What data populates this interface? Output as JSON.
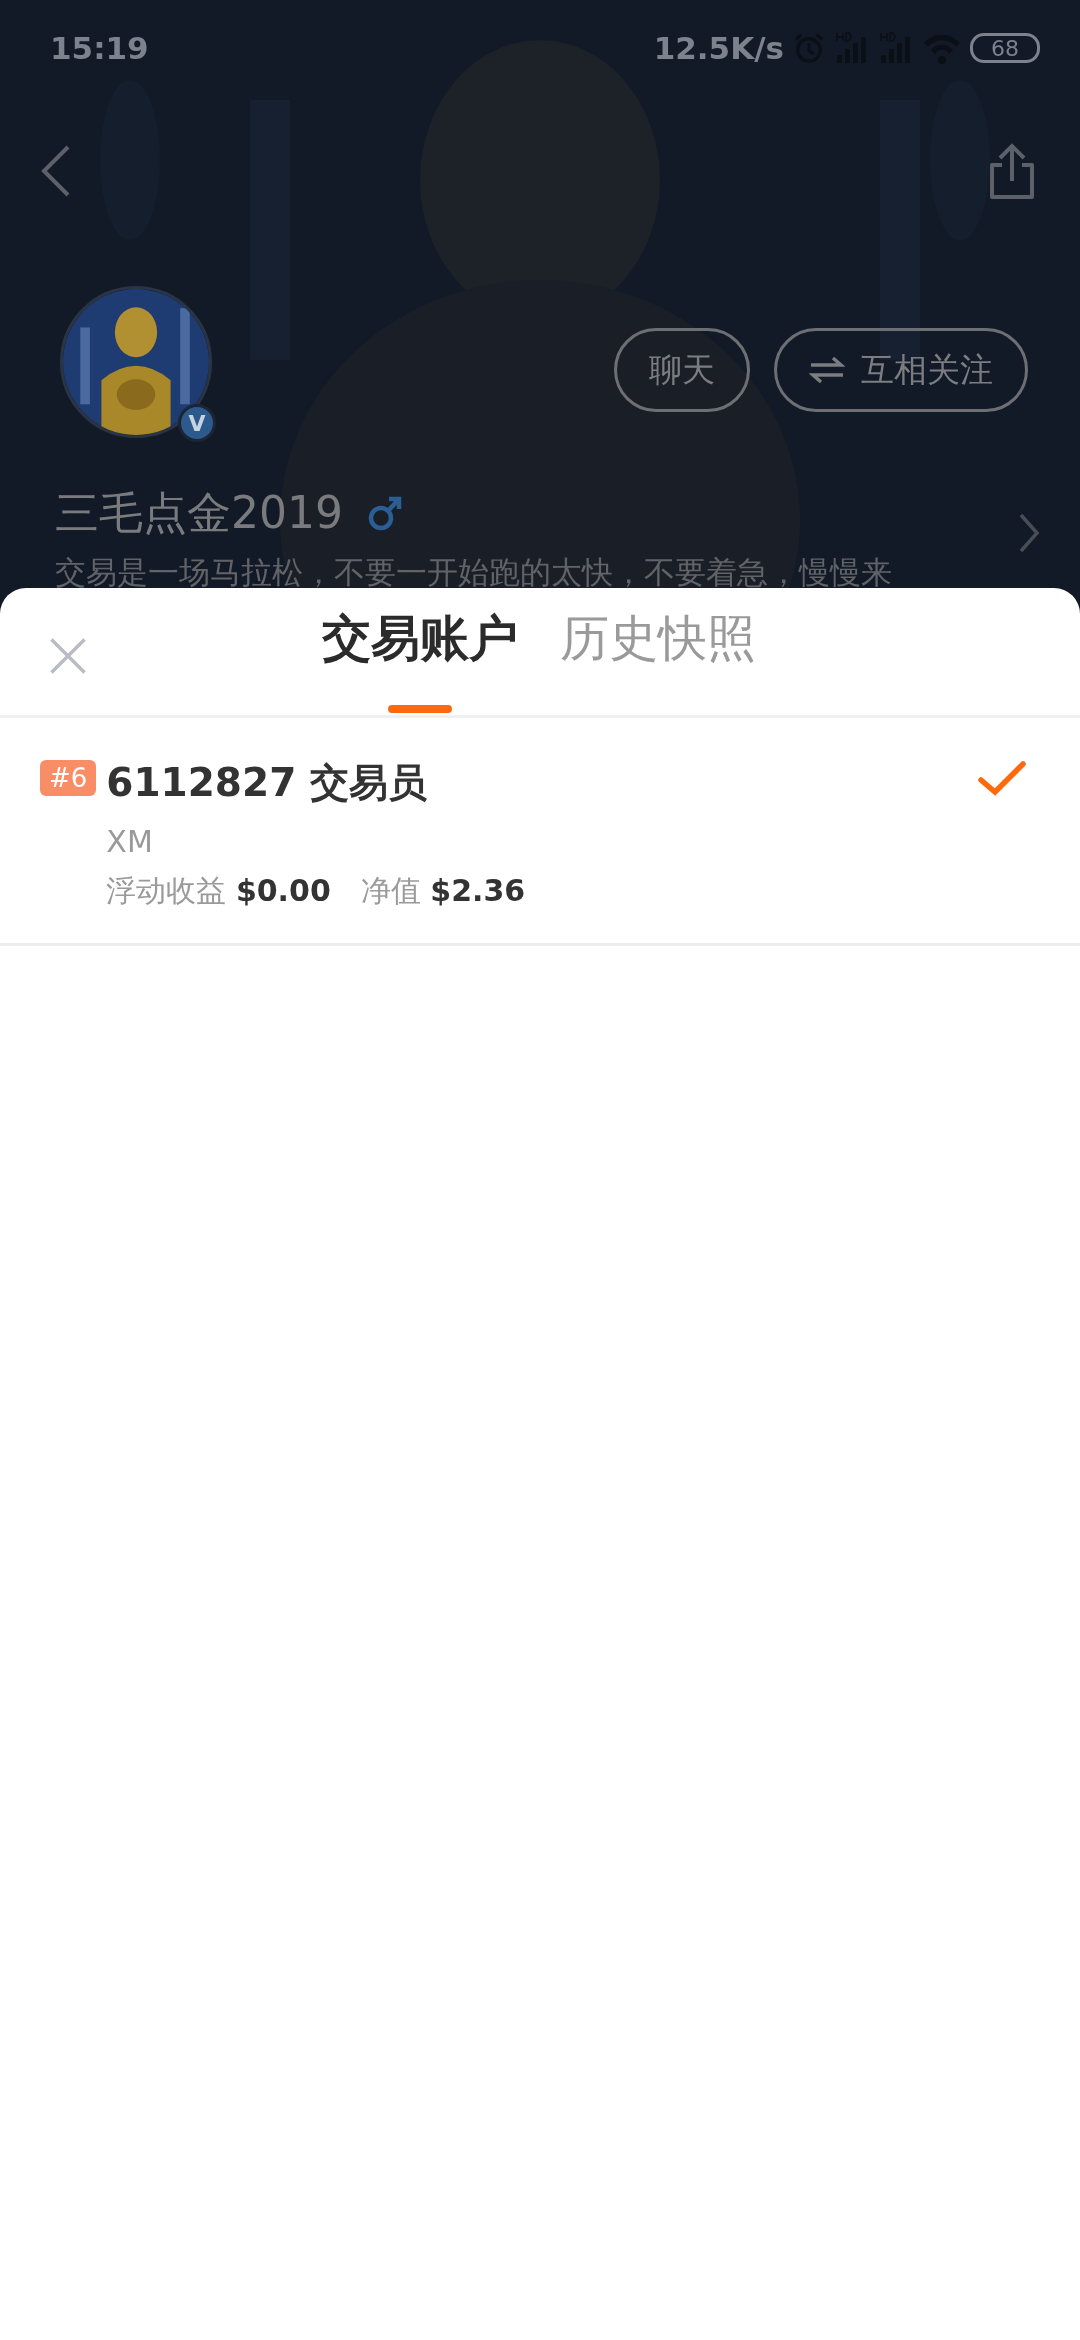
{
  "status_bar": {
    "time": "15:19",
    "network_speed": "12.5K/s",
    "battery": "68"
  },
  "profile": {
    "name": "三毛点金2019",
    "verified_badge": "V",
    "bio": "交易是一场马拉松，不要一开始跑的太快，不要着急，慢慢来",
    "buttons": [
      {
        "label": "聊天",
        "kind": "plain"
      },
      {
        "label": "互相关注",
        "kind": "mutual"
      }
    ]
  },
  "sheet": {
    "tabs": [
      {
        "label": "交易账户",
        "selected": true
      },
      {
        "label": "历史快照",
        "selected": false
      }
    ],
    "accounts": [
      {
        "rank": "#6",
        "title": "6112827 交易员",
        "broker": "XM",
        "floating_label": "浮动收益",
        "floating_value": "$0.00",
        "equity_label": "净值",
        "equity_value": "$2.36",
        "selected": true
      }
    ]
  }
}
